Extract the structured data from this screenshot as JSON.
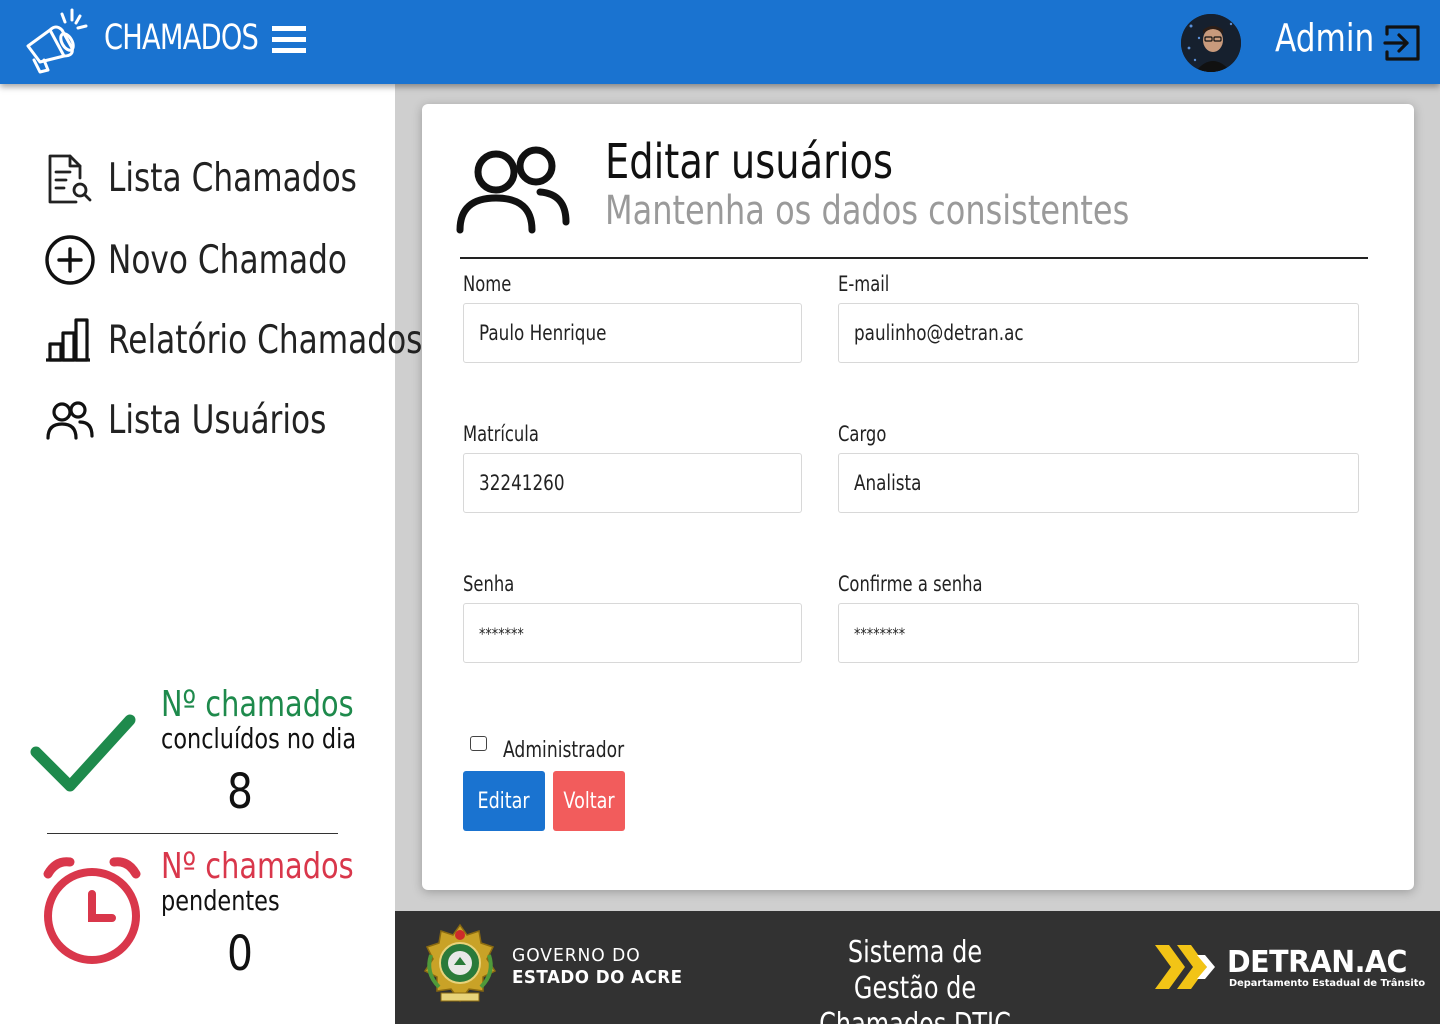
{
  "app": {
    "title": "CHAMADOS"
  },
  "header": {
    "user_name": "Admin"
  },
  "sidebar": {
    "items": [
      {
        "label": "Lista Chamados",
        "icon": "document-search-icon"
      },
      {
        "label": "Novo Chamado",
        "icon": "plus-circle-icon"
      },
      {
        "label": "Relatório Chamados",
        "icon": "bar-chart-icon"
      },
      {
        "label": "Lista Usuários",
        "icon": "users-icon"
      }
    ]
  },
  "stats": {
    "completed": {
      "title": "Nº chamados",
      "subtitle": "concluídos no dia",
      "value": "8",
      "color": "#1e8a4c"
    },
    "pending": {
      "title": "Nº chamados",
      "subtitle": "pendentes",
      "value": "0",
      "color": "#d9374b"
    }
  },
  "card": {
    "title": "Editar usuários",
    "subtitle": "Mantenha os dados consistentes",
    "fields": {
      "nome": {
        "label": "Nome",
        "value": "Paulo Henrique"
      },
      "email": {
        "label": "E-mail",
        "value": "paulinho@detran.ac"
      },
      "matricula": {
        "label": "Matrícula",
        "value": "32241260"
      },
      "cargo": {
        "label": "Cargo",
        "value": "Analista"
      },
      "senha": {
        "label": "Senha",
        "value": "*******"
      },
      "confirme": {
        "label": "Confirme a senha",
        "value": "********"
      }
    },
    "admin_checkbox": {
      "label": "Administrador",
      "checked": false
    },
    "buttons": {
      "edit": "Editar",
      "back": "Voltar"
    }
  },
  "footer": {
    "gov_line1": "GOVERNO DO",
    "gov_line2": "ESTADO DO ACRE",
    "system_line1": "Sistema de Gestão de",
    "system_line2": "Chamados DTIC",
    "detran_name": "DETRAN.AC",
    "detran_sub": "Departamento Estadual de Trânsito"
  },
  "colors": {
    "primary": "#1a73d0",
    "danger": "#f25c5c",
    "footer_bg": "#323232",
    "detran_yellow": "#f2c416"
  }
}
